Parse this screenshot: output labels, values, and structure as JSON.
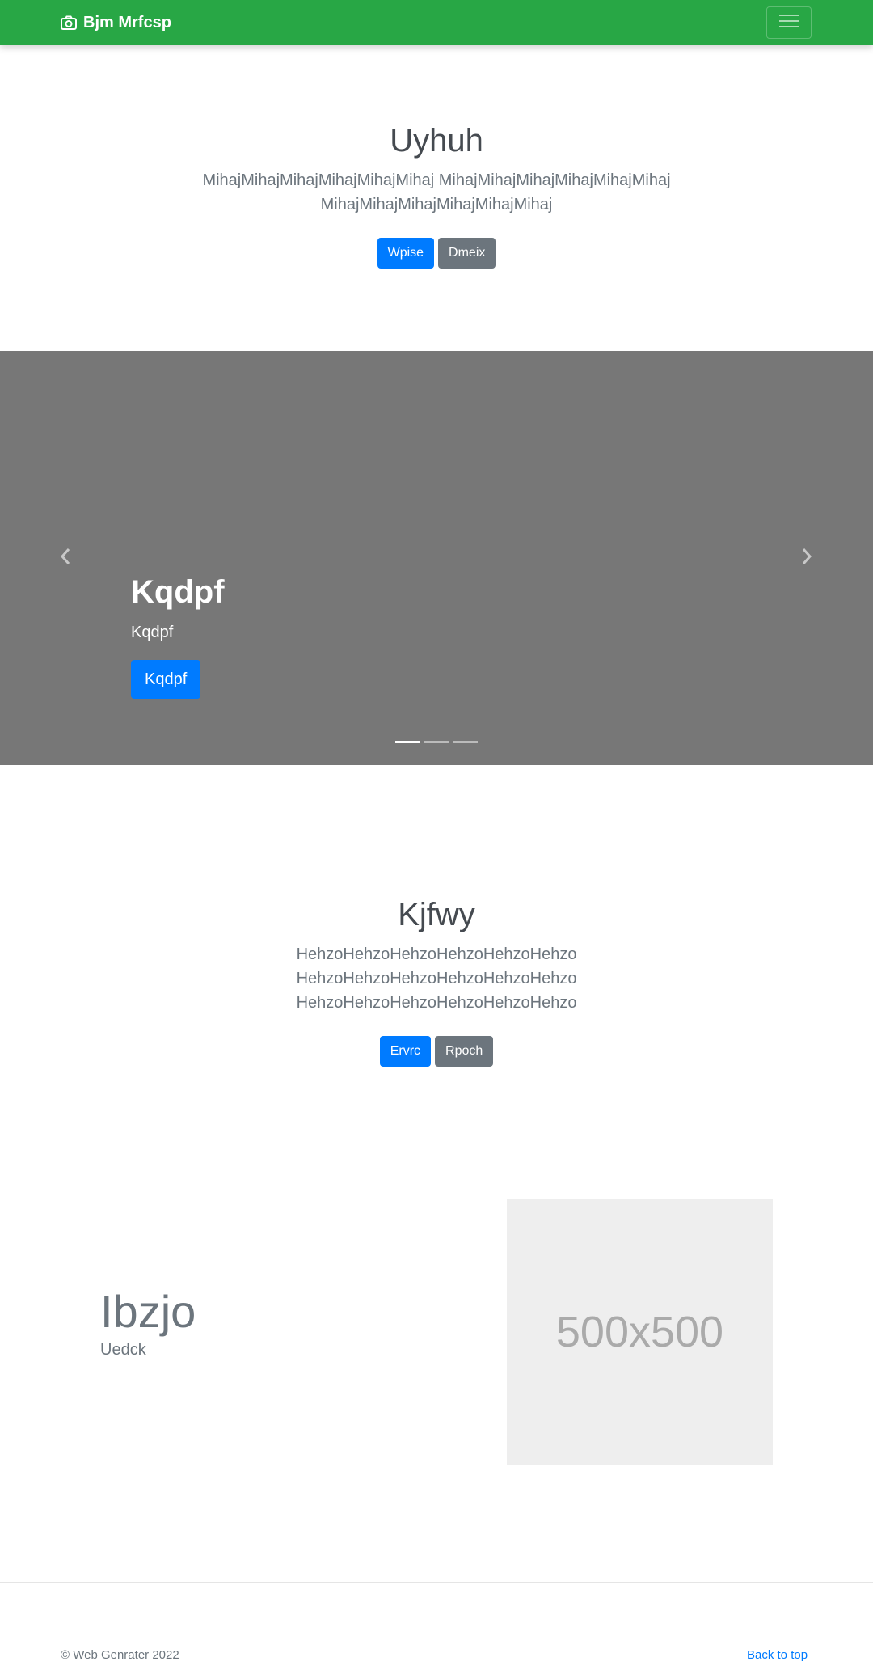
{
  "navbar": {
    "brand": "Bjm Mrfcsp",
    "brand_icon": "camera-icon",
    "toggler_icon": "hamburger-menu-icon"
  },
  "hero1": {
    "title": "Uyhuh",
    "text_line1": "MihajMihajMihajMihajMihajMihaj MihajMihajMihajMihajMihajMihaj",
    "text_line2": "MihajMihajMihajMihajMihajMihaj",
    "primary_button": "Wpise",
    "secondary_button": "Dmeix"
  },
  "carousel": {
    "caption_title": "Kqdpf",
    "caption_text": "Kqdpf",
    "caption_button": "Kqdpf",
    "prev_icon": "chevron-left-icon",
    "next_icon": "chevron-right-icon",
    "slide_count": 3,
    "active_slide": 1
  },
  "hero2": {
    "title": "Kjfwy",
    "text_line1": "HehzoHehzoHehzoHehzoHehzoHehzo",
    "text_line2": "HehzoHehzoHehzoHehzoHehzoHehzo",
    "text_line3": "HehzoHehzoHehzoHehzoHehzoHehzo",
    "primary_button": "Ervrc",
    "secondary_button": "Rpoch"
  },
  "feature": {
    "heading": "Ibzjo",
    "subtext": "Uedck",
    "image_label": "500x500"
  },
  "footer": {
    "copyright": "© Web Genrater 2022",
    "back_to_top": "Back to top"
  },
  "colors": {
    "navbar": "#28a745",
    "primary": "#007bff",
    "secondary": "#6c757d",
    "carousel_bg": "#777777",
    "placeholder_bg": "#eeeeee"
  }
}
